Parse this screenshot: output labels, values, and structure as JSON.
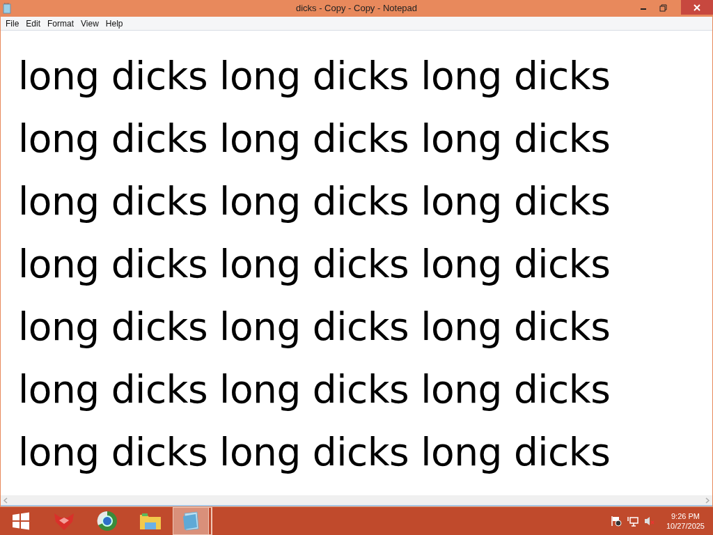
{
  "window": {
    "title": "dicks - Copy - Copy - Notepad"
  },
  "menu": [
    {
      "label": "File"
    },
    {
      "label": "Edit"
    },
    {
      "label": "Format"
    },
    {
      "label": "View"
    },
    {
      "label": "Help"
    }
  ],
  "document": {
    "lines": [
      "long dicks long dicks long dicks",
      "long dicks long dicks long dicks",
      "long dicks long dicks long dicks",
      "long dicks long dicks long dicks",
      "long dicks long dicks long dicks",
      "long dicks long dicks long dicks",
      "long dicks long dicks long dicks"
    ]
  },
  "taskbar": {
    "apps": [
      {
        "kind": "start",
        "selected": false
      },
      {
        "kind": "fox",
        "selected": false
      },
      {
        "kind": "browser",
        "selected": false
      },
      {
        "kind": "folder",
        "selected": false
      },
      {
        "kind": "notepad",
        "selected": true
      }
    ],
    "time": "9:26 PM",
    "date": "10/27/2025"
  }
}
